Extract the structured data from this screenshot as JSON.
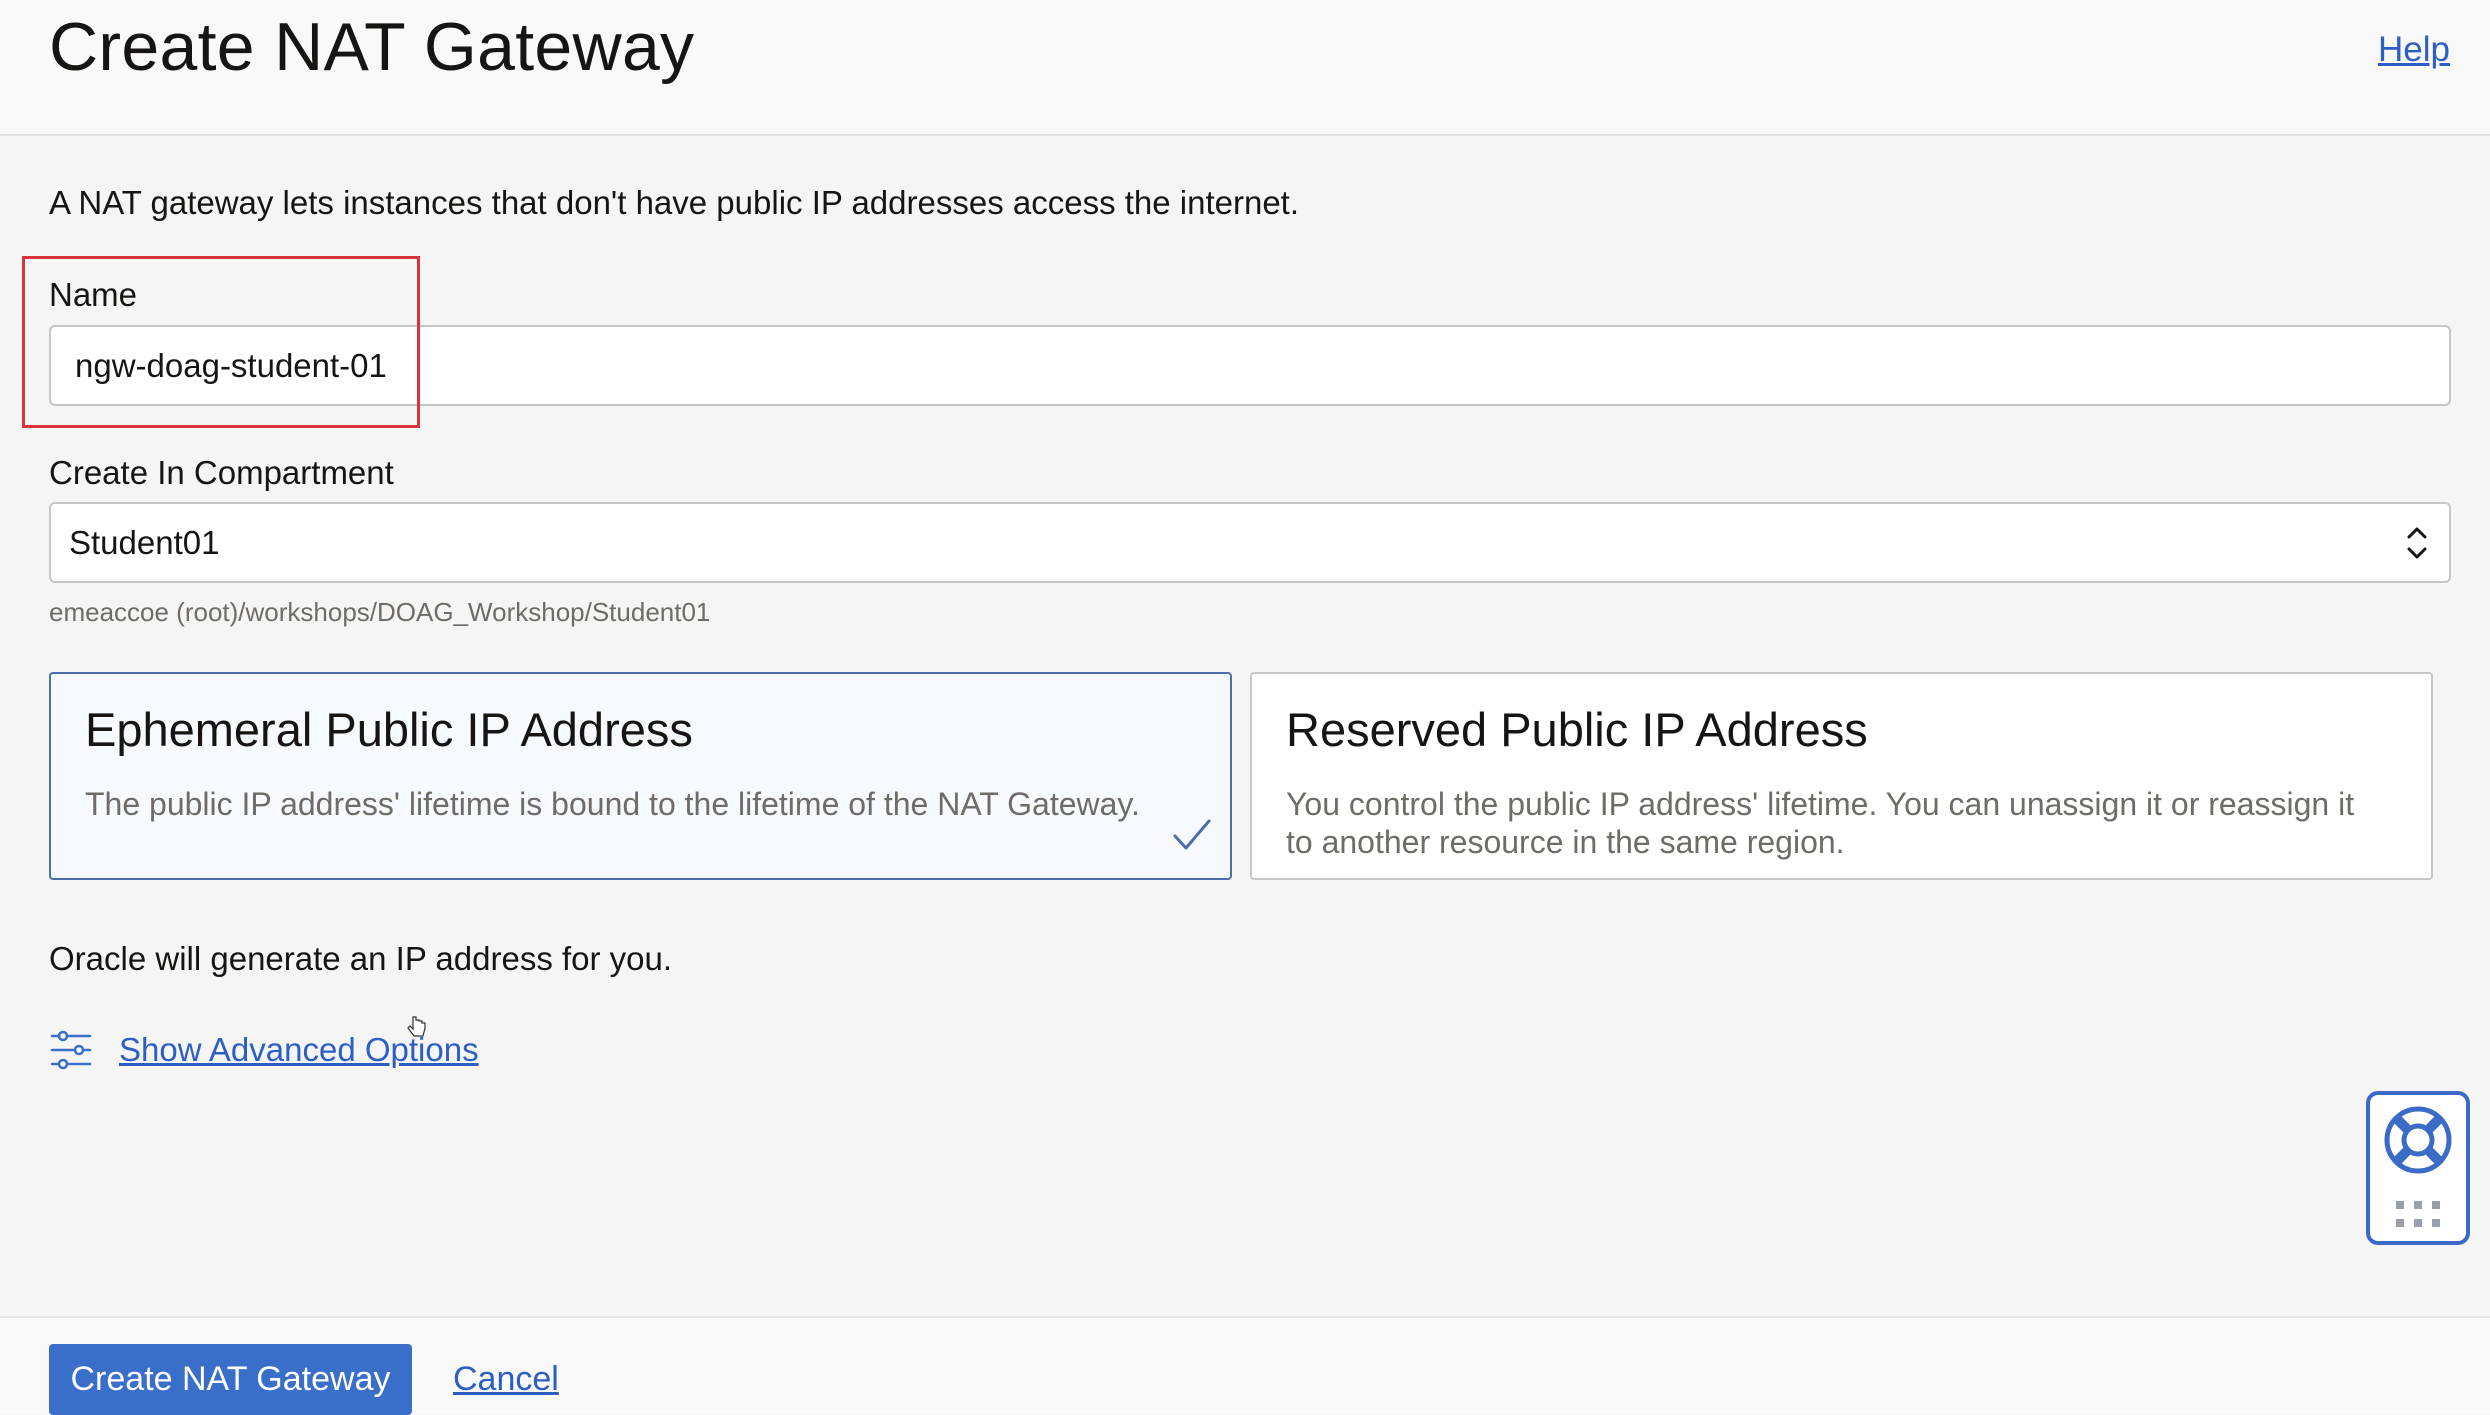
{
  "header": {
    "title": "Create NAT Gateway",
    "help_label": "Help"
  },
  "intro_text": "A NAT gateway lets instances that don't have public IP addresses access the internet.",
  "form": {
    "name": {
      "label": "Name",
      "value": "ngw-doag-student-01"
    },
    "compartment": {
      "label": "Create In Compartment",
      "value": "Student01",
      "path": "emeaccoe (root)/workshops/DOAG_Workshop/Student01"
    }
  },
  "ip_options": [
    {
      "title": "Ephemeral Public IP Address",
      "description": "The public IP address' lifetime is bound to the lifetime of the NAT Gateway.",
      "selected": true
    },
    {
      "title": "Reserved Public IP Address",
      "description": "You control the public IP address' lifetime. You can unassign it or reassign it to another resource in the same region.",
      "selected": false
    }
  ],
  "generate_note": "Oracle will generate an IP address for you.",
  "advanced": {
    "label": "Show Advanced Options",
    "icon": "sliders-icon"
  },
  "help_widget": {
    "icon": "lifebuoy-icon",
    "secondary_icon": "grip-dots-icon"
  },
  "footer": {
    "submit_label": "Create NAT Gateway",
    "cancel_label": "Cancel"
  },
  "colors": {
    "accent": "#3a6fc9",
    "link": "#2c5ec4",
    "highlight": "#d9343a",
    "selected_border": "#4d6ea8"
  }
}
